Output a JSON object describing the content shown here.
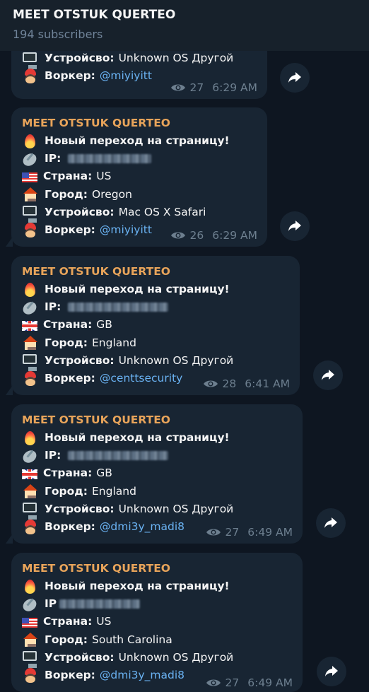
{
  "channel": {
    "title": "MEET OTSTUK QUERTEO",
    "subscribers": "194 subscribers"
  },
  "labels": {
    "device": "Устройсво:",
    "worker": "Воркер:",
    "ip": "IP:",
    "ip_alt": "IP",
    "country": "Страна:",
    "city": "Город:"
  },
  "messages": [
    {
      "device": "Unknown OS Другой",
      "worker": "@miyiyitt",
      "views": "27",
      "time": "6:29 AM"
    },
    {
      "author": "MEET OTSTUK QUERTEO",
      "event": "Новый переход на страницу!",
      "country": "US",
      "city": "Oregon",
      "device": "Mac OS X Safari",
      "worker": "@miyiyitt",
      "views": "26",
      "time": "6:29 AM"
    },
    {
      "author": "MEET OTSTUK QUERTEO",
      "event": "Новый переход на страницу!",
      "country": "GB",
      "city": "England",
      "device": "Unknown OS Другой",
      "worker": "@centtsecurity",
      "views": "28",
      "time": "6:41 AM"
    },
    {
      "author": "MEET OTSTUK QUERTEO",
      "event": "Новый переход на страницу!",
      "country": "GB",
      "city": "England",
      "device": "Unknown OS Другой",
      "worker": "@dmi3y_madi8",
      "views": "27",
      "time": "6:49 AM"
    },
    {
      "author": "MEET OTSTUK QUERTEO",
      "event": "Новый переход на страницу!",
      "country": "US",
      "city": "South Carolina",
      "device": "Unknown OS Другой",
      "worker": "@dmi3y_madi8",
      "views": "27",
      "time": "6:49 AM"
    }
  ],
  "icons": {
    "forward": "share-arrow-icon",
    "views": "eye-icon"
  },
  "colors": {
    "background": "#0e1621",
    "bubble": "#182533",
    "header": "#17212b",
    "author": "#e8a45a",
    "mention": "#6ab2f2",
    "meta": "#6d7f8f"
  }
}
